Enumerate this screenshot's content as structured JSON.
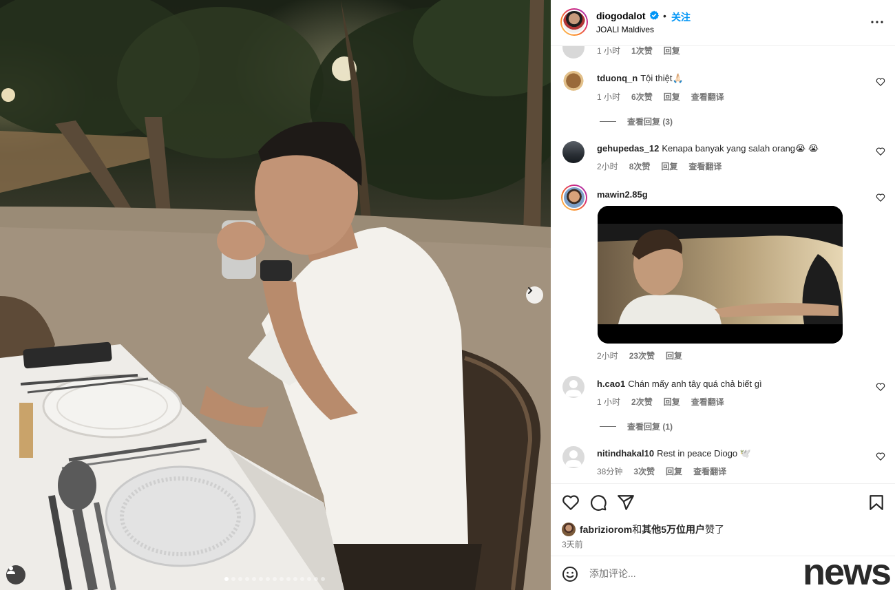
{
  "post": {
    "username": "diogodalot",
    "follow_label": "关注",
    "separator": "•",
    "location": "JOALI Maldives",
    "carousel": {
      "slide_count": 15,
      "active_index": 0
    }
  },
  "comments": {
    "partial_top": {
      "time": "1 小时",
      "likes": "1次赞",
      "reply": "回复"
    },
    "items": [
      {
        "username": "tduonq_n",
        "text": "Tội thiệt🙏🏻",
        "time": "1 小时",
        "likes": "6次赞",
        "reply": "回复",
        "translate": "查看翻译",
        "view_replies": "查看回复 (3)"
      },
      {
        "username": "gehupedas_12",
        "text": "Kenapa banyak yang salah orang😭 😭",
        "time": "2小时",
        "likes": "8次赞",
        "reply": "回复",
        "translate": "查看翻译"
      },
      {
        "username": "mawin2.85g",
        "text": "",
        "time": "2小时",
        "likes": "23次赞",
        "reply": "回复"
      },
      {
        "username": "h.cao1",
        "text": "Chán mấy anh tây quá chả biết gì",
        "time": "1 小时",
        "likes": "2次赞",
        "reply": "回复",
        "translate": "查看翻译",
        "view_replies": "查看回复 (1)"
      },
      {
        "username": "nitindhakal10",
        "text": "Rest in peace Diogo 🕊️",
        "time": "38分钟",
        "likes": "3次赞",
        "reply": "回复",
        "translate": "查看翻译"
      }
    ]
  },
  "likes": {
    "user": "fabriziorom",
    "connector": "和",
    "others": "其他5万位用户",
    "suffix": "赞了",
    "time_ago": "3天前"
  },
  "add_comment": {
    "placeholder": "添加评论..."
  },
  "watermark": "news",
  "icons": {
    "verified": "verified-badge-icon",
    "more": "more-options-icon",
    "like": "heart-icon",
    "comment": "comment-icon",
    "share": "paper-plane-icon",
    "save": "bookmark-icon",
    "emoji": "emoji-icon",
    "next": "chevron-right-icon",
    "tag": "tagged-user-icon"
  },
  "colors": {
    "accent": "#0095f6",
    "verified": "#0095f6",
    "text": "#262626",
    "muted": "#737373"
  }
}
